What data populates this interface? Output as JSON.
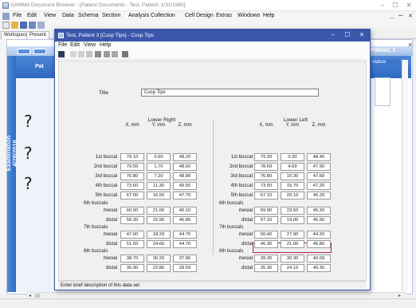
{
  "main_window": {
    "title": "GAMMA Document Browser - [Patient Documents - Test, Patient, 1/31/1980]",
    "menu": [
      "File",
      "Edit",
      "View",
      "Data",
      "Schema",
      "Section",
      "Analysis Collection",
      "Cell Design",
      "Extras",
      "Windows",
      "Help"
    ],
    "workspace_tabs": [
      "Workspace",
      "Present"
    ],
    "patient_header": "Patient, 1",
    "status_col": "status",
    "side_label": "Examination\n4/28/2016",
    "pat_label": "Pat",
    "close_glyph": "×"
  },
  "dialog": {
    "title": "Test, Patient 3 [Cusp Tips] - Cusp Tips",
    "menu": [
      "File",
      "Edit",
      "View",
      "Help"
    ],
    "title_label": "Title",
    "title_value": "Cusp Tips",
    "status_text": "Enter brief description of this data set",
    "col_headers": [
      "X, mm",
      "Y, mm",
      "Z, mm"
    ],
    "lower_right": {
      "title": "Lower Right",
      "rows": [
        {
          "label": "1st buccal",
          "values": [
            "79.10",
            "0.60",
            "48.20"
          ]
        },
        {
          "label": "2nd buccal",
          "values": [
            "79.50",
            "1.70",
            "48.60"
          ]
        },
        {
          "label": "3rd buccal",
          "values": [
            "76.80",
            "7.20",
            "48.80"
          ]
        },
        {
          "label": "4th buccal",
          "values": [
            "73.60",
            "11.30",
            "49.50"
          ]
        },
        {
          "label": "5th buccal",
          "values": [
            "67.00",
            "16.50",
            "47.70"
          ]
        },
        {
          "label": "mesial",
          "group": "6th buccals",
          "values": [
            "60.00",
            "21.00",
            "46.10"
          ]
        },
        {
          "label": "distal",
          "values": [
            "56.30",
            "15.90",
            "46.80"
          ]
        },
        {
          "label": "mesial",
          "group": "7th buccals",
          "values": [
            "47.00",
            "18.29",
            "44.70"
          ]
        },
        {
          "label": "distal",
          "values": [
            "51.50",
            "24.60",
            "44.70"
          ]
        },
        {
          "label": "mesial",
          "group": "8th buccals",
          "values": [
            "38.70",
            "30.20",
            "37.80"
          ]
        },
        {
          "label": "distal",
          "values": [
            "36.90",
            "22.80",
            "39.59"
          ]
        }
      ]
    },
    "lower_left": {
      "title": "Lower Left",
      "rows": [
        {
          "label": "1st buccal",
          "values": [
            "79.20",
            "0.30",
            "48.40"
          ]
        },
        {
          "label": "2nd buccal",
          "values": [
            "78.69",
            "4.69",
            "47.90"
          ]
        },
        {
          "label": "3rd buccal",
          "values": [
            "76.80",
            "10.30",
            "47.60"
          ]
        },
        {
          "label": "4th buccal",
          "values": [
            "73.50",
            "15.70",
            "47.20"
          ]
        },
        {
          "label": "5th buccal",
          "values": [
            "67.10",
            "20.10",
            "46.20"
          ]
        },
        {
          "label": "mesial",
          "group": "6th buccals",
          "values": [
            "59.90",
            "23.50",
            "45.20"
          ]
        },
        {
          "label": "distal",
          "values": [
            "57.10",
            "19.00",
            "45.90"
          ]
        },
        {
          "label": "mesial",
          "group": "7th buccals",
          "values": [
            "50.40",
            "27.90",
            "44.20"
          ]
        },
        {
          "label": "distal",
          "values": [
            "46.30",
            "21.00",
            "45.80"
          ]
        },
        {
          "label": "mesial",
          "group": "8th buccals",
          "values": [
            "39.30",
            "30.30",
            "40.09"
          ]
        },
        {
          "label": "distal",
          "values": [
            "35.30",
            "24.10",
            "40.30"
          ]
        }
      ]
    }
  },
  "colors": {
    "dialog_title": "#3b57ab",
    "accent_blue": "#2e6cc4",
    "selection": "#b0263f"
  }
}
